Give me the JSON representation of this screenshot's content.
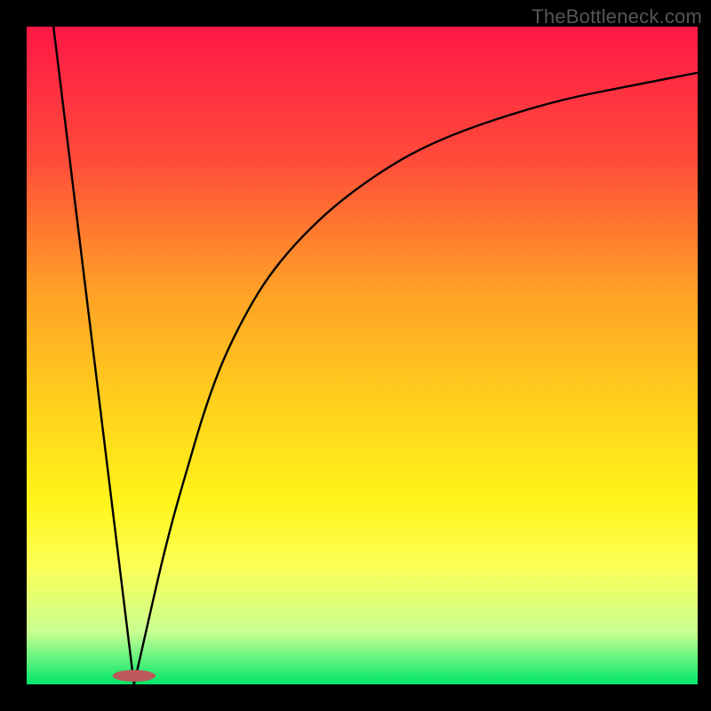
{
  "watermark": "TheBottleneck.com",
  "chart_data": {
    "type": "line",
    "title": "",
    "xlabel": "",
    "ylabel": "",
    "xlim": [
      0,
      100
    ],
    "ylim": [
      0,
      100
    ],
    "grid": false,
    "background_gradient": {
      "stops": [
        {
          "offset": 0.0,
          "color": "#ff1846"
        },
        {
          "offset": 0.2,
          "color": "#ff4b3a"
        },
        {
          "offset": 0.4,
          "color": "#ffa026"
        },
        {
          "offset": 0.58,
          "color": "#ffd21c"
        },
        {
          "offset": 0.72,
          "color": "#fff41a"
        },
        {
          "offset": 0.82,
          "color": "#fcff55"
        },
        {
          "offset": 0.92,
          "color": "#c9ff91"
        },
        {
          "offset": 1.0,
          "color": "#00e66b"
        }
      ]
    },
    "marker": {
      "cx": 16,
      "cy": 98.7,
      "rx": 3.2,
      "ry": 0.9,
      "fill": "#bb595b"
    },
    "series": [
      {
        "name": "left-line",
        "x": [
          4,
          16
        ],
        "y": [
          100,
          0
        ]
      },
      {
        "name": "right-curve",
        "x": [
          16,
          18,
          20,
          22,
          24,
          26,
          28,
          30,
          33,
          36,
          40,
          45,
          50,
          56,
          62,
          70,
          80,
          90,
          100
        ],
        "y": [
          0,
          9,
          18,
          26,
          33,
          40,
          46,
          51,
          57,
          62,
          67,
          72,
          76,
          80,
          83,
          86,
          89,
          91,
          93
        ]
      }
    ]
  }
}
